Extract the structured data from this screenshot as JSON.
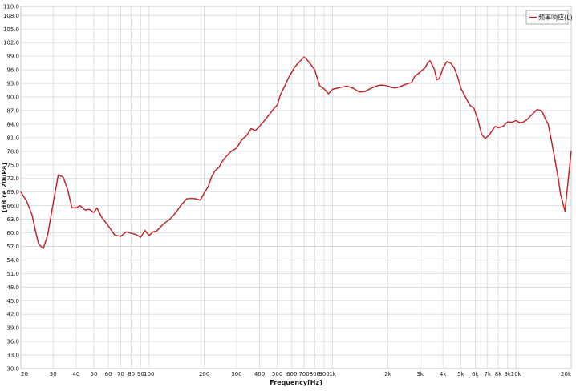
{
  "chart_data": {
    "type": "line",
    "title": "",
    "xlabel": "Frequency[Hz]",
    "ylabel": "[dB re 20uPa]",
    "x_scale": "log",
    "xlim": [
      20,
      20000
    ],
    "ylim": [
      30,
      110
    ],
    "grid": true,
    "legend_position": "top-right",
    "x_ticks": [
      20,
      30,
      40,
      50,
      60,
      70,
      80,
      90,
      100,
      200,
      300,
      400,
      500,
      600,
      700,
      800,
      900,
      1000,
      2000,
      3000,
      4000,
      5000,
      6000,
      7000,
      8000,
      9000,
      10000,
      20000
    ],
    "x_tick_labels": [
      "20",
      "30",
      "40",
      "50",
      "60",
      "70",
      "80",
      "90",
      "100",
      "200",
      "300",
      "400",
      "500",
      "600",
      "700",
      "800",
      "900",
      "1k",
      "2k",
      "3k",
      "4k",
      "5k",
      "6k",
      "7k",
      "8k",
      "9k",
      "10k",
      "20k"
    ],
    "y_ticks": [
      30,
      33,
      36,
      39,
      42,
      45,
      48,
      51,
      54,
      57,
      60,
      63,
      66,
      69,
      72,
      75,
      78,
      81,
      84,
      87,
      90,
      93,
      96,
      99,
      102,
      105,
      108,
      110
    ],
    "y_tick_labels": [
      "30.0",
      "33.0",
      "36.0",
      "39.0",
      "42.0",
      "45.0",
      "48.0",
      "51.0",
      "54.0",
      "57.0",
      "60.0",
      "63.0",
      "66.0",
      "69.0",
      "72.0",
      "75.0",
      "78.0",
      "81.0",
      "84.0",
      "87.0",
      "90.0",
      "93.0",
      "96.0",
      "99.0",
      "102.0",
      "105.0",
      "108.0",
      "110.0"
    ],
    "series": [
      {
        "name": "频率响应(L)",
        "color": "#c0282d",
        "x": [
          20,
          21.5,
          23,
          24,
          25,
          26.5,
          28,
          30,
          32,
          34,
          36,
          38,
          40,
          42,
          45,
          47,
          50,
          52,
          55,
          60,
          65,
          70,
          75,
          80,
          85,
          90,
          95,
          100,
          105,
          110,
          120,
          130,
          140,
          150,
          160,
          170,
          180,
          190,
          200,
          210,
          220,
          230,
          240,
          250,
          260,
          280,
          300,
          320,
          340,
          360,
          380,
          400,
          420,
          450,
          480,
          500,
          520,
          550,
          580,
          600,
          620,
          650,
          680,
          700,
          720,
          750,
          800,
          850,
          900,
          950,
          1000,
          1100,
          1200,
          1300,
          1400,
          1500,
          1600,
          1700,
          1800,
          1900,
          2000,
          2100,
          2200,
          2300,
          2400,
          2500,
          2600,
          2700,
          2800,
          2900,
          3000,
          3100,
          3200,
          3300,
          3400,
          3500,
          3600,
          3700,
          3800,
          3900,
          4000,
          4200,
          4400,
          4600,
          4800,
          5000,
          5300,
          5600,
          5900,
          6200,
          6500,
          6800,
          7100,
          7400,
          7700,
          8000,
          8500,
          9000,
          9500,
          10000,
          10500,
          11000,
          11500,
          12000,
          12500,
          13000,
          13500,
          14000,
          14500,
          15000,
          16000,
          17000,
          17500,
          18500,
          20000
        ],
        "y": [
          69,
          67,
          64,
          60.5,
          57.5,
          56.5,
          59.5,
          66.5,
          72.8,
          72.3,
          69.5,
          65.5,
          65.5,
          66,
          65,
          65.2,
          64.5,
          65.5,
          63.5,
          61.5,
          59.5,
          59.2,
          60.2,
          59.9,
          59.6,
          59,
          60.5,
          59.4,
          60.2,
          60.4,
          62,
          63,
          64.5,
          66.2,
          67.5,
          67.6,
          67.5,
          67.2,
          68.8,
          70.2,
          72.5,
          73.8,
          74.4,
          75.7,
          76.6,
          78,
          78.7,
          80.5,
          81.5,
          83,
          82.6,
          83.5,
          84.5,
          86,
          87.5,
          88.2,
          90.5,
          92.5,
          94.5,
          95.5,
          96.5,
          97.5,
          98.3,
          98.8,
          98.4,
          97.5,
          96,
          92.5,
          91.8,
          90.7,
          91.7,
          92.1,
          92.4,
          91.9,
          91.1,
          91.2,
          91.8,
          92.3,
          92.6,
          92.6,
          92.4,
          92.1,
          92,
          92.2,
          92.5,
          92.8,
          93,
          93.2,
          94.5,
          95,
          95.5,
          96,
          96.5,
          97.5,
          98,
          97,
          96,
          93.8,
          94,
          95,
          96.4,
          97.8,
          97.5,
          96.5,
          94.5,
          92,
          90,
          88.2,
          87.5,
          85,
          81.7,
          80.8,
          81.5,
          82.5,
          83.5,
          83.2,
          83.5,
          84.5,
          84.4,
          84.8,
          84.3,
          84.5,
          85,
          85.8,
          86.5,
          87.2,
          87.1,
          86.5,
          85,
          84,
          78,
          72,
          68.5,
          64.8,
          78
        ]
      }
    ]
  }
}
